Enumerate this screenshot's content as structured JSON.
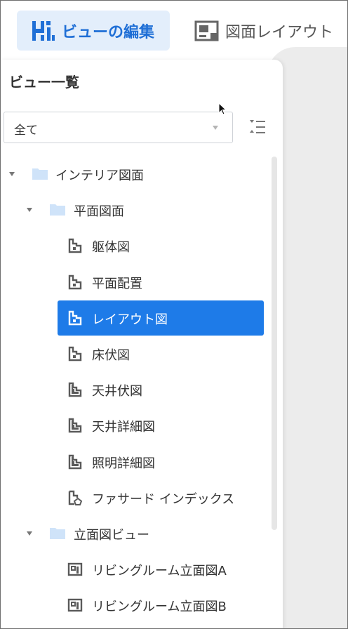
{
  "tabs": [
    {
      "label": "ビューの編集",
      "icon": "hi-logo-icon",
      "active": true
    },
    {
      "label": "図面レイアウト",
      "icon": "sheet-layout-icon",
      "active": false
    }
  ],
  "panel": {
    "title": "ビュー一覧",
    "filter": {
      "value": "全て"
    }
  },
  "tree": [
    {
      "label": "インテリア図面",
      "icon": "folder-icon",
      "expanded": true,
      "level": 0
    },
    {
      "label": "平面図面",
      "icon": "folder-icon",
      "expanded": true,
      "level": 1
    },
    {
      "label": "躯体図",
      "icon": "floor-plan-icon",
      "level": 2
    },
    {
      "label": "平面配置",
      "icon": "floor-plan-icon",
      "level": 2
    },
    {
      "label": "レイアウト図",
      "icon": "floor-plan-icon",
      "level": 2,
      "selected": true
    },
    {
      "label": "床伏図",
      "icon": "floor-plan-icon",
      "level": 2
    },
    {
      "label": "天井伏図",
      "icon": "ceiling-plan-icon",
      "level": 2
    },
    {
      "label": "天井詳細図",
      "icon": "ceiling-plan-icon",
      "level": 2
    },
    {
      "label": "照明詳細図",
      "icon": "ceiling-plan-icon",
      "level": 2
    },
    {
      "label": "ファサード インデックス",
      "icon": "facade-plan-icon",
      "level": 2
    },
    {
      "label": "立面図ビュー",
      "icon": "folder-icon",
      "expanded": true,
      "level": 1
    },
    {
      "label": "リビングルーム立面図A",
      "icon": "elevation-icon",
      "level": 2
    },
    {
      "label": "リビングルーム立面図B",
      "icon": "elevation-icon",
      "level": 2
    }
  ],
  "colors": {
    "accent": "#1e7be8",
    "tab_active_bg": "#e3eefb",
    "folder": "#cfe3f9"
  }
}
